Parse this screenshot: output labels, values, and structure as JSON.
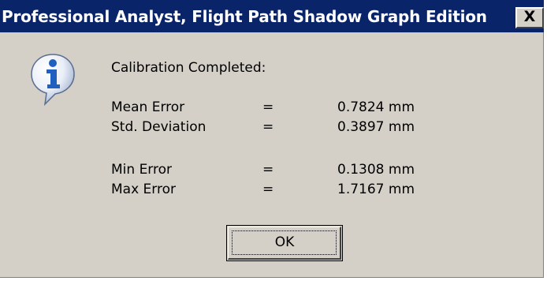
{
  "window": {
    "title": "Professional Analyst, Flight Path Shadow Graph Edition",
    "close_label": "X"
  },
  "icon": "info-icon",
  "message": {
    "heading": "Calibration Completed:",
    "stats": [
      {
        "label": "Mean Error",
        "sep": "=",
        "value": "0.7824 mm"
      },
      {
        "label": "Std. Deviation",
        "sep": "=",
        "value": "0.3897 mm"
      },
      {
        "label": "Min Error",
        "sep": "=",
        "value": "0.1308 mm"
      },
      {
        "label": "Max Error",
        "sep": "=",
        "value": "1.7167 mm"
      }
    ]
  },
  "buttons": {
    "ok_label": "OK"
  },
  "colors": {
    "titlebar": "#0a246a",
    "dialog_face": "#d4d0c8",
    "icon_blue": "#1f5fbf"
  }
}
